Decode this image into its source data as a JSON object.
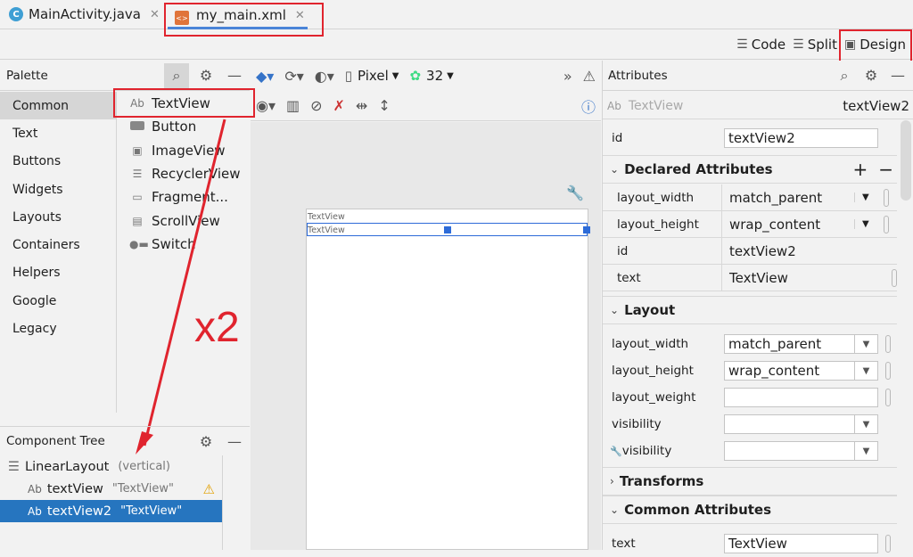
{
  "tabs": [
    {
      "label": "MainActivity.java",
      "icon": "java-class-icon"
    },
    {
      "label": "my_main.xml",
      "icon": "xml-file-icon"
    }
  ],
  "modes": {
    "code": "Code",
    "split": "Split",
    "design": "Design"
  },
  "palette": {
    "title": "Palette",
    "categories": [
      "Common",
      "Text",
      "Buttons",
      "Widgets",
      "Layouts",
      "Containers",
      "Helpers",
      "Google",
      "Legacy"
    ],
    "items": [
      {
        "icon": "Ab",
        "label": "TextView"
      },
      {
        "icon": "",
        "label": "Button"
      },
      {
        "icon": "",
        "label": "ImageView"
      },
      {
        "icon": "",
        "label": "RecyclerView"
      },
      {
        "icon": "",
        "label": "Fragment..."
      },
      {
        "icon": "",
        "label": "ScrollView"
      },
      {
        "icon": "",
        "label": "Switch"
      }
    ]
  },
  "design_toolbar": {
    "device": "Pixel",
    "api": "32"
  },
  "canvas": {
    "label1": "TextView",
    "label2": "TextView"
  },
  "annotation": "x2",
  "tree": {
    "title": "Component Tree",
    "root": {
      "label": "LinearLayout",
      "meta": "(vertical)"
    },
    "children": [
      {
        "icon": "Ab",
        "label": "textView",
        "meta": "\"TextView\""
      },
      {
        "icon": "Ab",
        "label": "textView2",
        "meta": "\"TextView\""
      }
    ]
  },
  "attributes": {
    "title": "Attributes",
    "component_icon": "Ab",
    "component_type": "TextView",
    "component_id": "textView2",
    "id_label": "id",
    "id_value": "textView2",
    "declared": {
      "title": "Declared Attributes",
      "rows": [
        {
          "name": "layout_width",
          "value": "match_parent"
        },
        {
          "name": "layout_height",
          "value": "wrap_content"
        },
        {
          "name": "id",
          "value": "textView2"
        },
        {
          "name": "text",
          "value": "TextView"
        }
      ]
    },
    "layout": {
      "title": "Layout",
      "rows": [
        {
          "name": "layout_width",
          "value": "match_parent"
        },
        {
          "name": "layout_height",
          "value": "wrap_content"
        },
        {
          "name": "layout_weight",
          "value": ""
        },
        {
          "name": "visibility",
          "value": ""
        },
        {
          "name": "visibility",
          "value": ""
        }
      ]
    },
    "transforms": {
      "title": "Transforms"
    },
    "common": {
      "title": "Common Attributes",
      "rows": [
        {
          "name": "text",
          "value": "TextView"
        }
      ]
    }
  }
}
